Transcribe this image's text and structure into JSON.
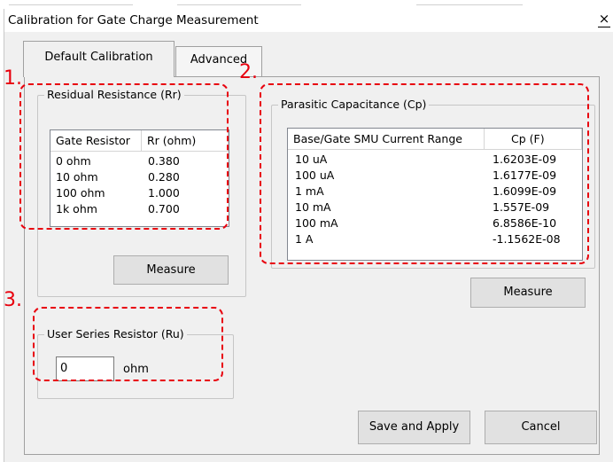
{
  "window": {
    "title": "Calibration for Gate Charge Measurement",
    "close_glyph": "×"
  },
  "tabs": {
    "default": "Default Calibration",
    "advanced": "Advanced"
  },
  "residual": {
    "legend": "Residual Resistance (Rr)",
    "headers": [
      "Gate Resistor",
      "Rr (ohm)"
    ],
    "rows": [
      [
        "0 ohm",
        "0.380"
      ],
      [
        "10 ohm",
        "0.280"
      ],
      [
        "100 ohm",
        "1.000"
      ],
      [
        "1k ohm",
        "0.700"
      ]
    ],
    "measure_label": "Measure"
  },
  "parasitic": {
    "legend": "Parasitic Capacitance (Cp)",
    "headers": [
      "Base/Gate SMU Current Range",
      "Cp (F)"
    ],
    "rows": [
      [
        "10 uA",
        "1.6203E-09"
      ],
      [
        "100 uA",
        "1.6177E-09"
      ],
      [
        "1 mA",
        "1.6099E-09"
      ],
      [
        "10 mA",
        "1.557E-09"
      ],
      [
        "100 mA",
        "6.8586E-10"
      ],
      [
        "1 A",
        "-1.1562E-08"
      ]
    ],
    "measure_label": "Measure"
  },
  "series": {
    "legend": "User Series Resistor (Ru)",
    "value": "0",
    "unit": "ohm"
  },
  "buttons": {
    "save": "Save and Apply",
    "cancel": "Cancel"
  },
  "annotations": {
    "one": "1.",
    "two": "2.",
    "three": "3.",
    "color": "#e8000d"
  }
}
